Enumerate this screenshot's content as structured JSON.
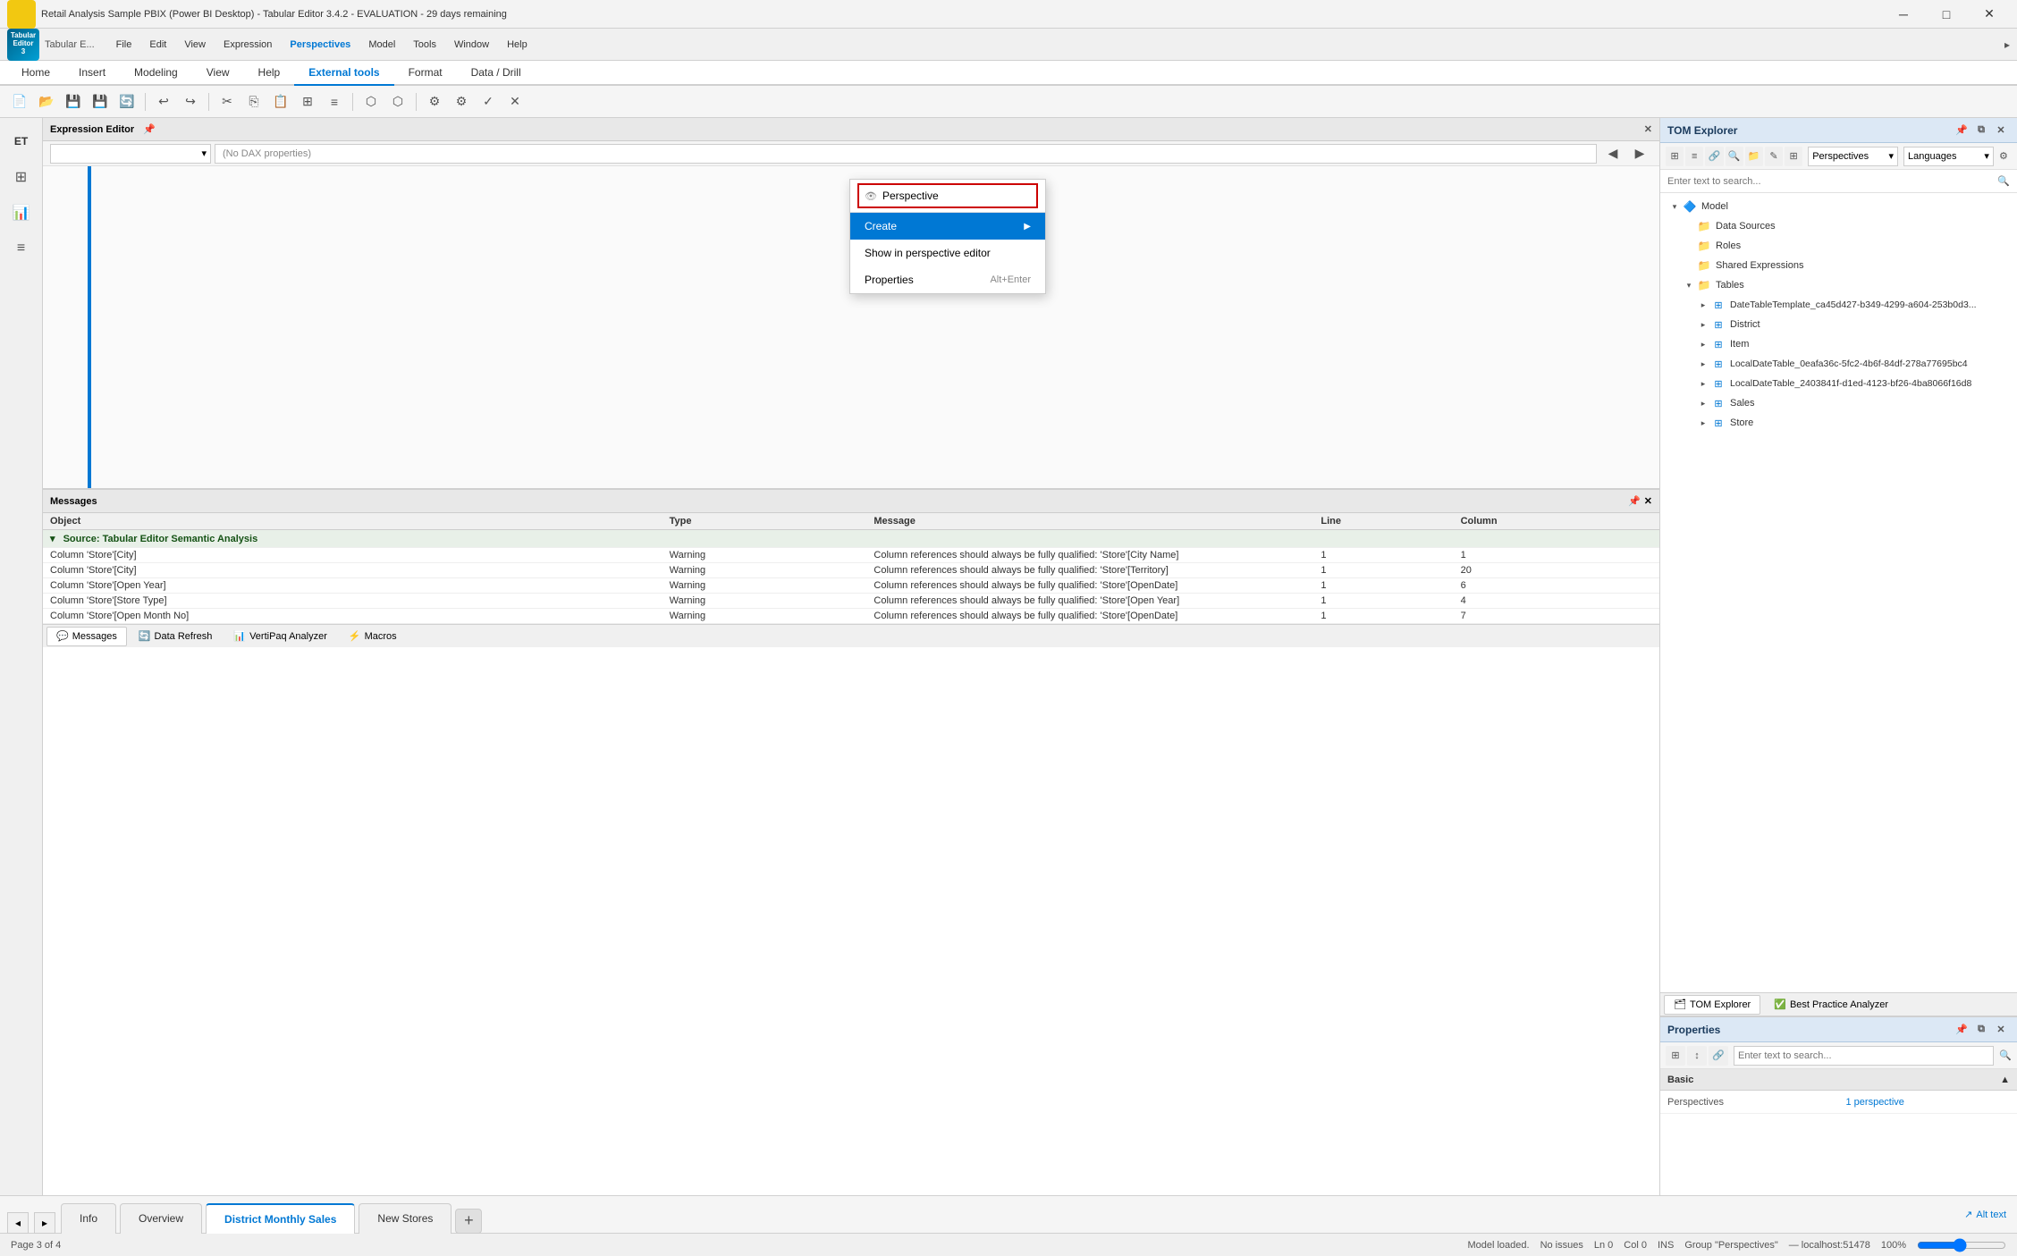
{
  "titleBar": {
    "title": "Retail Analysis Sample PBIX (Power BI Desktop) - Tabular Editor 3.4.2 - EVALUATION - 29 days remaining",
    "minimize": "─",
    "maximize": "□",
    "close": "✕"
  },
  "menuBar": {
    "items": [
      "File",
      "Edit",
      "View",
      "Expression",
      "Perspectives",
      "Model",
      "Tools",
      "Window",
      "Help"
    ]
  },
  "ribbonTabs": {
    "tabs": [
      "Home",
      "Insert",
      "Modeling",
      "View",
      "Help",
      "External tools",
      "Format",
      "Data / Drill"
    ],
    "activeTab": "External tools"
  },
  "expressionEditor": {
    "title": "Expression Editor",
    "placeholder": "(No DAX properties)",
    "dropdownValue": ""
  },
  "tomExplorer": {
    "title": "TOM Explorer",
    "searchPlaceholder": "Enter text to search...",
    "dropdowns": {
      "perspectives": "Perspectives",
      "languages": "Languages"
    },
    "tree": {
      "model": "Model",
      "dataSources": "Data Sources",
      "roles": "Roles",
      "sharedExpressions": "Shared Expressions",
      "tables": "Tables",
      "tableItems": [
        "DateTableTemplate_ca45d427-b349-4299-a604-253b0d3...",
        "District",
        "Item",
        "LocalDateTable_0eafa36c-5fc2-4b6f-84df-278a77695bc4",
        "LocalDateTable_2403841f-d1ed-4123-bf26-4ba8066f16d8",
        "Sales",
        "Store"
      ]
    }
  },
  "contextMenu": {
    "perspectiveLabel": "Perspective",
    "items": [
      {
        "label": "Create",
        "shortcut": "▶",
        "highlighted": true
      },
      {
        "label": "Show in perspective editor",
        "shortcut": ""
      },
      {
        "label": "Properties",
        "shortcut": "Alt+Enter"
      }
    ]
  },
  "properties": {
    "title": "Properties",
    "searchPlaceholder": "Enter text to search...",
    "section": "Basic",
    "rows": [
      {
        "key": "Perspectives",
        "value": "1 perspective"
      }
    ]
  },
  "panelFooterTabs": [
    "TOM Explorer",
    "Best Practice Analyzer"
  ],
  "messages": {
    "title": "Messages",
    "columns": [
      "Object",
      "Type",
      "Message",
      "Line",
      "Column"
    ],
    "groupLabel": "Source: Tabular Editor Semantic Analysis",
    "rows": [
      {
        "object": "Column 'Store'[City]",
        "type": "Warning",
        "message": "Column references should always be fully qualified: 'Store'[City Name]",
        "line": "1",
        "col": "1"
      },
      {
        "object": "Column 'Store'[City]",
        "type": "Warning",
        "message": "Column references should always be fully qualified: 'Store'[Territory]",
        "line": "1",
        "col": "20"
      },
      {
        "object": "Column 'Store'[Open Year]",
        "type": "Warning",
        "message": "Column references should always be fully qualified: 'Store'[OpenDate]",
        "line": "1",
        "col": "6"
      },
      {
        "object": "Column 'Store'[Store Type]",
        "type": "Warning",
        "message": "Column references should always be fully qualified: 'Store'[Open Year]",
        "line": "1",
        "col": "4"
      },
      {
        "object": "Column 'Store'[Open Month No]",
        "type": "Warning",
        "message": "Column references should always be fully qualified: 'Store'[OpenDate]",
        "line": "1",
        "col": "7"
      }
    ]
  },
  "messageTabs": [
    {
      "label": "Messages",
      "icon": "💬",
      "active": true
    },
    {
      "label": "Data Refresh",
      "icon": "🔄",
      "active": false
    },
    {
      "label": "VertiPaq Analyzer",
      "icon": "📊",
      "active": false
    },
    {
      "label": "Macros",
      "icon": "⚡",
      "active": false
    }
  ],
  "pageTabs": [
    {
      "label": "Info",
      "active": false
    },
    {
      "label": "Overview",
      "active": false
    },
    {
      "label": "District Monthly Sales",
      "active": true
    },
    {
      "label": "New Stores",
      "active": false
    }
  ],
  "altText": "↗ Alt text",
  "statusBar": {
    "left": "Model loaded.",
    "noIssues": "No issues",
    "ln": "Ln 0",
    "col": "Col 0",
    "ins": "INS",
    "group": "Group \"Perspectives\"",
    "host": "localhost:51478",
    "pageInfo": "Page 3 of 4",
    "zoom": "100%"
  },
  "icons": {
    "search": "🔍",
    "pin": "📌",
    "close": "✕",
    "chevronDown": "▾",
    "chevronRight": "▸",
    "chevronLeft": "◂",
    "expand": "▸",
    "collapse": "▾",
    "plus": "+",
    "minus": "-",
    "folder": "📁",
    "table": "⊞",
    "model": "🔷",
    "copy": "⎘",
    "save": "💾",
    "undo": "↩",
    "redo": "↪",
    "grid": "⊞",
    "check": "✓",
    "arrow": "▶"
  }
}
